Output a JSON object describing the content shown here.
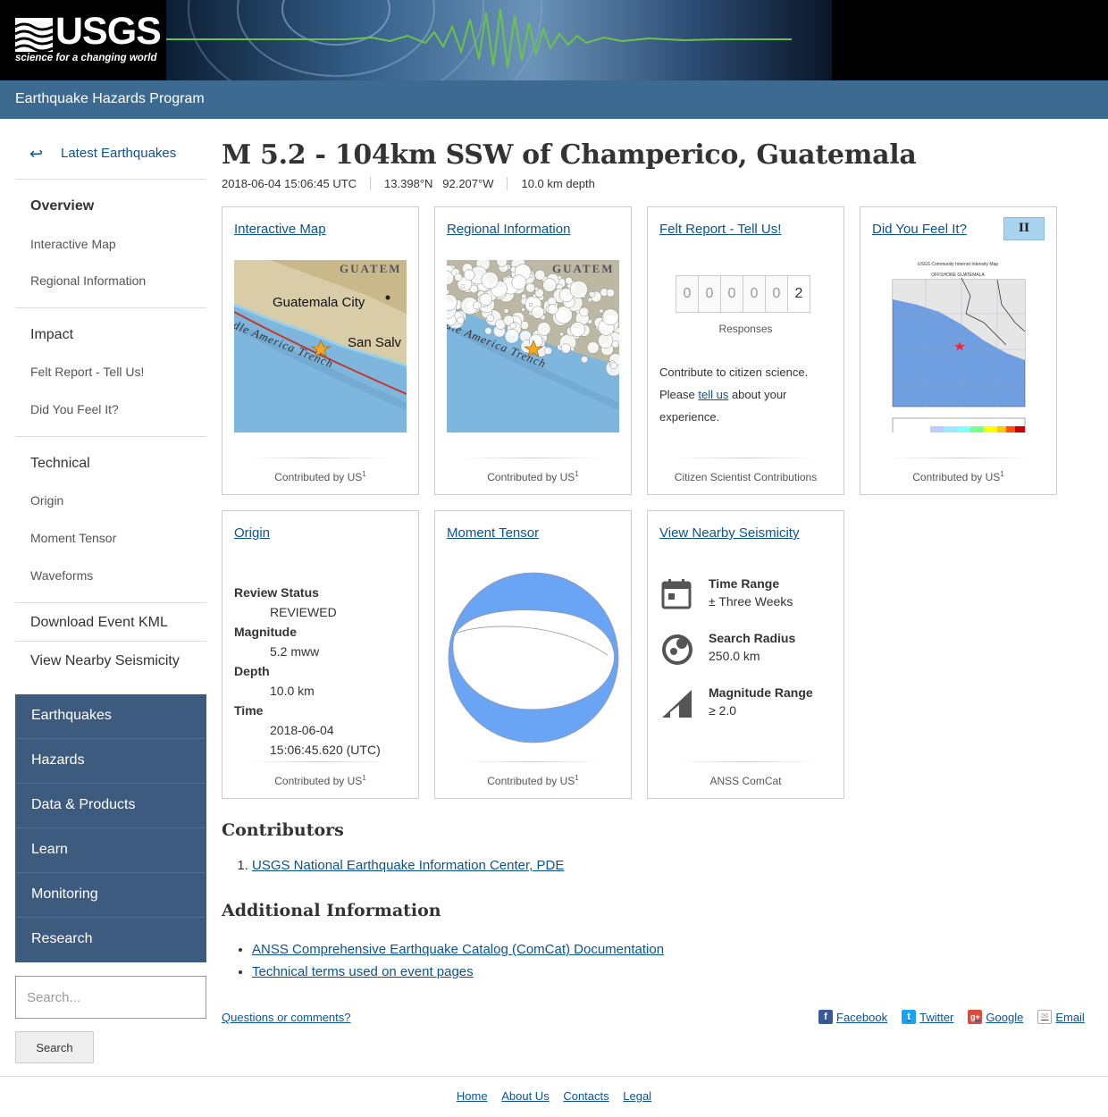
{
  "header": {
    "logo_text": "USGS",
    "logo_tagline": "science for a changing world",
    "program": "Earthquake Hazards Program"
  },
  "sidebar": {
    "back_label": "Latest Earthquakes",
    "overview": "Overview",
    "overview_items": [
      "Interactive Map",
      "Regional Information"
    ],
    "impact": "Impact",
    "impact_items": [
      "Felt Report - Tell Us!",
      "Did You Feel It?"
    ],
    "technical": "Technical",
    "technical_items": [
      "Origin",
      "Moment Tensor",
      "Waveforms"
    ],
    "download_kml": "Download Event KML",
    "nearby": "View Nearby Seismicity"
  },
  "site_nav": [
    "Earthquakes",
    "Hazards",
    "Data & Products",
    "Learn",
    "Monitoring",
    "Research"
  ],
  "search": {
    "placeholder": "Search...",
    "button": "Search"
  },
  "event": {
    "title": "M 5.2 - 104km SSW of Champerico, Guatemala",
    "time": "2018-06-04 15:06:45 UTC",
    "lat": "13.398°N",
    "lon": "92.207°W",
    "depth": "10.0 km depth"
  },
  "cards": {
    "interactive_map": {
      "title": "Interactive Map",
      "contributed": "Contributed by US",
      "sup": "1",
      "map_labels": [
        "GUATEM",
        "Guatemala City",
        "San Salv",
        "dle America Trench"
      ]
    },
    "regional": {
      "title": "Regional Information",
      "contributed": "Contributed by US",
      "sup": "1",
      "map_labels": [
        "GUATEM",
        "dle America Trench"
      ]
    },
    "felt": {
      "title": "Felt Report - Tell Us!",
      "digits": [
        "0",
        "0",
        "0",
        "0",
        "0",
        "2"
      ],
      "responses_label": "Responses",
      "text_before": "Contribute to citizen science. Please ",
      "link": "tell us",
      "text_after": " about your experience.",
      "foot": "Citizen Scientist Contributions"
    },
    "dyfi": {
      "title": "Did You Feel It?",
      "badge": "II",
      "contributed": "Contributed by US",
      "sup": "1",
      "map_title": "USGS Community Internet Intensity Map",
      "map_subtitle": "OFFSHORE GUATEMALA"
    },
    "origin": {
      "title": "Origin",
      "fields": [
        {
          "label": "Review Status",
          "values": [
            "REVIEWED"
          ]
        },
        {
          "label": "Magnitude",
          "values": [
            "5.2 mww"
          ]
        },
        {
          "label": "Depth",
          "values": [
            "10.0 km"
          ]
        },
        {
          "label": "Time",
          "values": [
            "2018-06-04",
            "15:06:45.620 (UTC)"
          ]
        }
      ],
      "contributed": "Contributed by US",
      "sup": "1"
    },
    "moment_tensor": {
      "title": "Moment Tensor",
      "contributed": "Contributed by US",
      "sup": "1"
    },
    "nearby": {
      "title": "View Nearby Seismicity",
      "rows": [
        {
          "label": "Time Range",
          "value": "± Three Weeks",
          "icon": "calendar-icon"
        },
        {
          "label": "Search Radius",
          "value": "250.0 km",
          "icon": "radius-icon"
        },
        {
          "label": "Magnitude Range",
          "value": "≥ 2.0",
          "icon": "magnitude-icon"
        }
      ],
      "foot": "ANSS ComCat"
    }
  },
  "contributors": {
    "heading": "Contributors",
    "items": [
      "USGS National Earthquake Information Center, PDE"
    ]
  },
  "additional": {
    "heading": "Additional Information",
    "items": [
      "ANSS Comprehensive Earthquake Catalog (ComCat) Documentation",
      "Technical terms used on event pages"
    ]
  },
  "questions": "Questions or comments?",
  "share": [
    "Facebook",
    "Twitter",
    "Google",
    "Email"
  ],
  "footer_links": [
    "Home",
    "About Us",
    "Contacts",
    "Legal"
  ],
  "colors": {
    "nav_blue": "#3d5a7f",
    "program_bar": "#3d6a90",
    "link": "#0b5394",
    "mt_fill": "#6aa4f4",
    "dyfi_badge": "#a9d4f0"
  }
}
